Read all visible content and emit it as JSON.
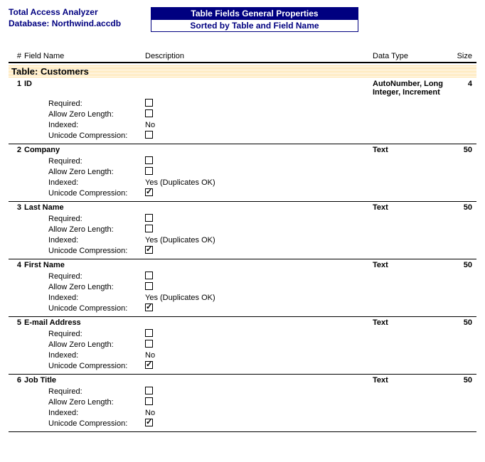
{
  "header": {
    "app_title": "Total Access Analyzer",
    "db_label": "Database:",
    "db_name": "Northwind.accdb",
    "box1": "Table Fields General Properties",
    "box2": "Sorted by Table and Field Name"
  },
  "columns": {
    "num": "#",
    "field": "Field Name",
    "desc": "Description",
    "type": "Data Type",
    "size": "Size"
  },
  "table_title_prefix": "Table:",
  "table_name": "Customers",
  "prop_labels": {
    "required": "Required:",
    "allow_zero": "Allow Zero Length:",
    "indexed": "Indexed:",
    "unicode": "Unicode Compression:"
  },
  "fields": [
    {
      "num": "1",
      "name": "ID",
      "desc": "",
      "type": "AutoNumber, Long Integer, Increment",
      "size": "4",
      "required": false,
      "allow_zero": false,
      "indexed_cb": false,
      "indexed_text": "No",
      "unicode": false
    },
    {
      "num": "2",
      "name": "Company",
      "desc": "",
      "type": "Text",
      "size": "50",
      "required": false,
      "allow_zero": false,
      "indexed_cb": false,
      "indexed_text": "Yes (Duplicates OK)",
      "unicode": true
    },
    {
      "num": "3",
      "name": "Last Name",
      "desc": "",
      "type": "Text",
      "size": "50",
      "required": false,
      "allow_zero": false,
      "indexed_cb": false,
      "indexed_text": "Yes (Duplicates OK)",
      "unicode": true
    },
    {
      "num": "4",
      "name": "First Name",
      "desc": "",
      "type": "Text",
      "size": "50",
      "required": false,
      "allow_zero": false,
      "indexed_cb": false,
      "indexed_text": "Yes (Duplicates OK)",
      "unicode": true
    },
    {
      "num": "5",
      "name": "E-mail Address",
      "desc": "",
      "type": "Text",
      "size": "50",
      "required": false,
      "allow_zero": false,
      "indexed_cb": false,
      "indexed_text": "No",
      "unicode": true
    },
    {
      "num": "6",
      "name": "Job Title",
      "desc": "",
      "type": "Text",
      "size": "50",
      "required": false,
      "allow_zero": false,
      "indexed_cb": false,
      "indexed_text": "No",
      "unicode": true
    }
  ]
}
